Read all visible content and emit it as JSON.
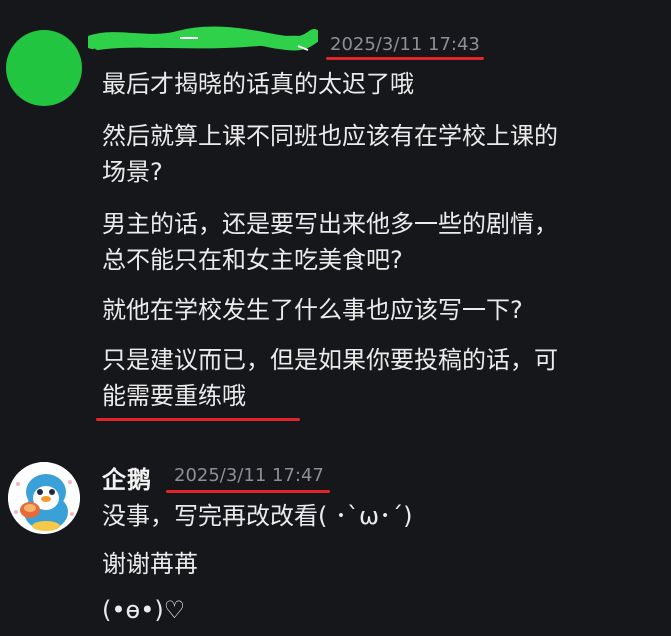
{
  "messages": [
    {
      "username": "",
      "timestamp": "2025/3/11 17:43",
      "lines": [
        "最后才揭晓的话真的太迟了哦",
        "然后就算上课不同班也应该有在学校上课的",
        "场景?",
        "男主的话，还是要写出来他多一些的剧情，",
        "总不能只在和女主吃美食吧?",
        "就他在学校发生了什么事也应该写一下?",
        "只是建议而已，但是如果你要投稿的话，可",
        "能需要重练哦"
      ]
    },
    {
      "username": "企鹅",
      "timestamp": "2025/3/11 17:47",
      "lines": [
        "没事，写完再改改看( ･`ω･´)",
        "谢谢苒苒",
        "(•ө•)♡"
      ]
    }
  ],
  "colors": {
    "background": "#16171b",
    "text": "#ebebeb",
    "timestamp": "#8e8f96",
    "annotation_red": "#e0262c",
    "avatar_green": "#22c540",
    "scribble_green": "#2fd14a"
  }
}
